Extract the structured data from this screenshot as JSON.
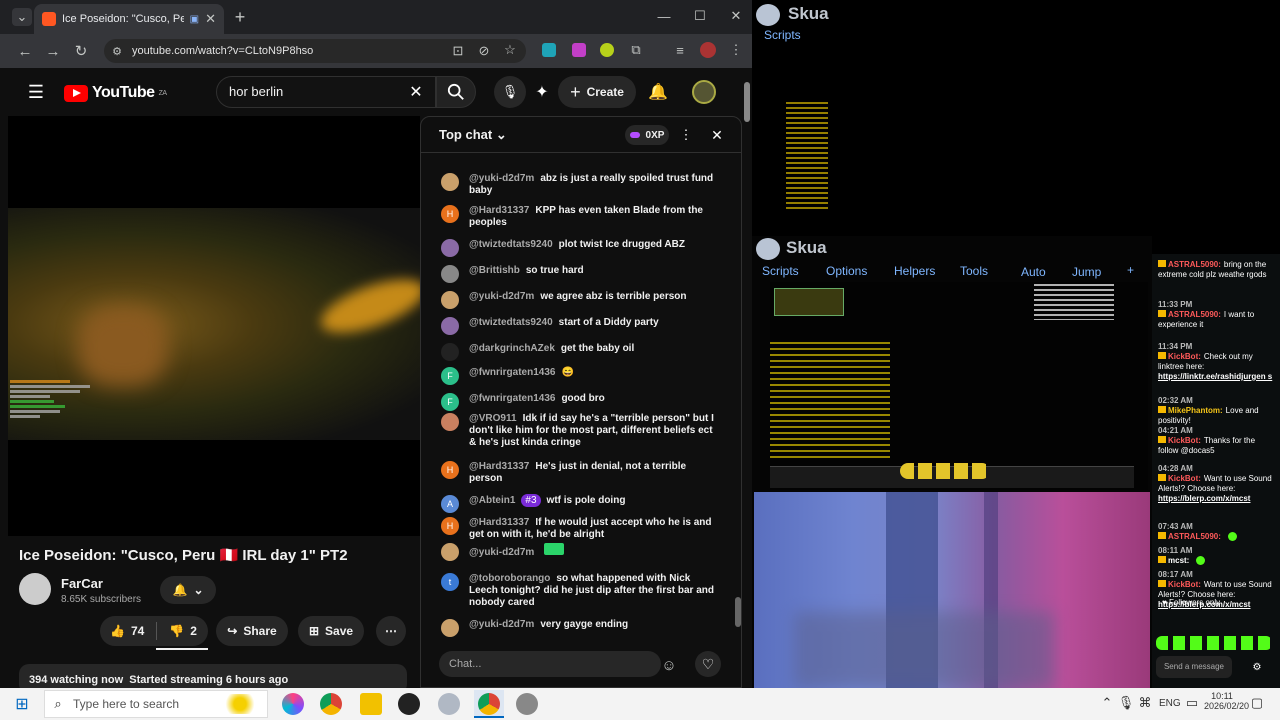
{
  "browser": {
    "tab_title": "Ice Poseidon: \"Cusco, Peru",
    "url": "youtube.com/watch?v=CLtoN9P8hso"
  },
  "youtube": {
    "logo": "YouTube",
    "region": "ZA",
    "search_value": "hor berlin",
    "create_label": "Create",
    "video_title": "Ice Poseidon: \"Cusco, Peru 🇵🇪 IRL day 1\" PT2",
    "channel_name": "FarCar",
    "subscribers": "8.65K subscribers",
    "likes": "74",
    "dislikes": "2",
    "share_label": "Share",
    "save_label": "Save",
    "watching": "394 watching now",
    "started": "Started streaming 6 hours ago"
  },
  "chat": {
    "header": "Top chat",
    "xp_badge": "0XP",
    "input_placeholder": "Chat...",
    "messages": [
      {
        "author": "@yuki-d2d7m",
        "text": "abz is just a really spoiled trust fund baby",
        "color": "#c9a06b",
        "initial": ""
      },
      {
        "author": "@Hard31337",
        "text": "KPP has even taken Blade from the peoples",
        "color": "#e8711c",
        "initial": "H"
      },
      {
        "author": "@twiztedtats9240",
        "text": "plot twist Ice drugged ABZ",
        "color": "#8a6aa6",
        "initial": ""
      },
      {
        "author": "@Brittishb",
        "text": "so true hard",
        "color": "#888888",
        "initial": ""
      },
      {
        "author": "@yuki-d2d7m",
        "text": "we agree abz is terrible person",
        "color": "#c9a06b",
        "initial": ""
      },
      {
        "author": "@twiztedtats9240",
        "text": "start of a Diddy party",
        "color": "#8a6aa6",
        "initial": ""
      },
      {
        "author": "@darkgrinchAZek",
        "text": "get the baby oil",
        "color": "#222222",
        "initial": ""
      },
      {
        "author": "@fwnrirgaten1436",
        "text": "😄",
        "color": "#2bbf8a",
        "initial": "F"
      },
      {
        "author": "@fwnrirgaten1436",
        "text": "good bro",
        "color": "#2bbf8a",
        "initial": "F"
      },
      {
        "author": "@VRO911",
        "text": "Idk if id say he's a \"terrible person\" but I don't like him for the most part, different beliefs ect & he's just kinda cringe",
        "color": "#c98060",
        "initial": ""
      },
      {
        "author": "@Hard31337",
        "text": "He's just in denial, not a terrible person",
        "color": "#e8711c",
        "initial": "H"
      },
      {
        "author": "@Abtein1",
        "badge": "#3",
        "text": "wtf is pole doing",
        "color": "#5a8ad6",
        "initial": "A"
      },
      {
        "author": "@Hard31337",
        "text": "If he would just accept who he is and get on with it, he'd be alright",
        "color": "#e8711c",
        "initial": "H"
      },
      {
        "author": "@yuki-d2d7m",
        "text": "",
        "color": "#c9a06b",
        "initial": ""
      },
      {
        "author": "@toboroborango",
        "text": "so what happened with Nick Leech tonight? did he just dip after the first bar and nobody cared",
        "color": "#3a7ad6",
        "initial": "t"
      },
      {
        "author": "@yuki-d2d7m",
        "text": "very gayge ending",
        "color": "#c9a06b",
        "initial": ""
      }
    ]
  },
  "skua": {
    "title": "Skua",
    "menu": [
      "Scripts",
      "Options",
      "Helpers",
      "Tools",
      "Auto",
      "Jump",
      "+"
    ],
    "menu_small": "Scripts"
  },
  "kick": {
    "messages": [
      {
        "time": "",
        "user": "ASTRAL5090:",
        "user_color": "#ff5a5a",
        "text": "bring on the extreme cold plz weathe rgods"
      },
      {
        "time": "11:33 PM",
        "user": "ASTRAL5090:",
        "user_color": "#ff5a5a",
        "text": "I want to experience it"
      },
      {
        "time": "11:34 PM",
        "user": "KickBot:",
        "user_color": "#ff5a5a",
        "text": "Check out my linktree here:",
        "link": "https://linktr.ee/rashidjurgen s"
      },
      {
        "time": "02:32 AM",
        "user": "MikePhantom:",
        "user_color": "#f5c518",
        "text": "Love and positivity!"
      },
      {
        "time": "04:21 AM",
        "user": "KickBot:",
        "user_color": "#ff5a5a",
        "text": "Thanks for the follow @docas5"
      },
      {
        "time": "04:28 AM",
        "user": "KickBot:",
        "user_color": "#ff5a5a",
        "text": "Want to use Sound Alerts!? Choose here:",
        "link": "https://blerp.com/x/mcst"
      },
      {
        "time": "07:43 AM",
        "user": "ASTRAL5090:",
        "user_color": "#ff5a5a",
        "text": ""
      },
      {
        "time": "08:11 AM",
        "user": "mcst:",
        "user_color": "#ffffff",
        "text": ""
      },
      {
        "time": "08:17 AM",
        "user": "KickBot:",
        "user_color": "#ff5a5a",
        "text": "Want to use Sound Alerts!? Choose here:",
        "link": "https://blerp.com/x/mcst"
      }
    ],
    "followers_only": "Followers only",
    "send_placeholder": "Send a message"
  },
  "taskbar": {
    "search_placeholder": "Type here to search",
    "lang": "ENG",
    "time": "10:11",
    "date": "2026/02/20"
  }
}
